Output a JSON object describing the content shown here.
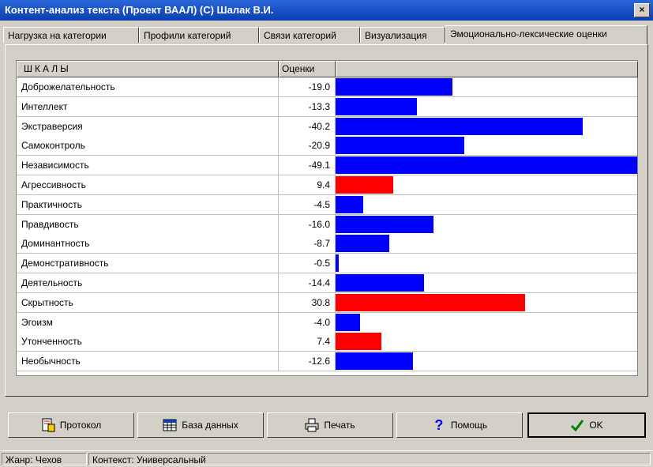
{
  "window": {
    "title": "Контент-анализ текста (Проект ВААЛ) (С) Шалак В.И.",
    "close_glyph": "×"
  },
  "tabs": [
    {
      "label": "Нагрузка на категории",
      "active": false
    },
    {
      "label": "Профили категорий",
      "active": false
    },
    {
      "label": "Связи категорий",
      "active": false
    },
    {
      "label": "Визуализация",
      "active": false
    },
    {
      "label": "Эмоционально-лексические оценки",
      "active": true
    }
  ],
  "grid": {
    "col_name": "ШКАЛЫ",
    "col_value": "Оценки",
    "max_abs": 49.1,
    "positive_color": "#ff0000",
    "negative_color": "#0000ff",
    "rows": [
      {
        "name": "Доброжелательность",
        "value": "-19.0"
      },
      {
        "name": "Интеллект",
        "value": "-13.3"
      },
      {
        "name": "Экстраверсия",
        "value": "-40.2"
      },
      {
        "name": "Самоконтроль",
        "value": "-20.9"
      },
      {
        "name": "Независимость",
        "value": "-49.1"
      },
      {
        "name": "Агрессивность",
        "value": "9.4"
      },
      {
        "name": "Практичность",
        "value": "-4.5"
      },
      {
        "name": "Правдивость",
        "value": "-16.0"
      },
      {
        "name": "Доминантность",
        "value": "-8.7"
      },
      {
        "name": "Демонстративность",
        "value": "-0.5"
      },
      {
        "name": "Деятельность",
        "value": "-14.4"
      },
      {
        "name": "Скрытность",
        "value": "30.8"
      },
      {
        "name": "Эгоизм",
        "value": "-4.0"
      },
      {
        "name": "Утонченность",
        "value": "7.4"
      },
      {
        "name": "Необычность",
        "value": "-12.6"
      }
    ]
  },
  "buttons": {
    "protocol": "Протокол",
    "database": "База данных",
    "print": "Печать",
    "help": "Помощь",
    "ok": "OK"
  },
  "status": {
    "genre": "Жанр: Чехов",
    "context": "Контекст: Универсальный"
  }
}
